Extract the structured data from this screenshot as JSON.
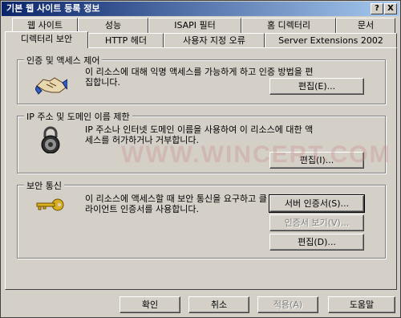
{
  "window": {
    "title": "기본 웹 사이트 등록 정보",
    "help_label": "?",
    "close_label": "X"
  },
  "tabs_row1": [
    {
      "label": "웹 사이트"
    },
    {
      "label": "성능"
    },
    {
      "label": "ISAPI 필터"
    },
    {
      "label": "홈 디렉터리"
    },
    {
      "label": "문서"
    }
  ],
  "tabs_row2": [
    {
      "label": "디렉터리 보안",
      "active": true
    },
    {
      "label": "HTTP 헤더"
    },
    {
      "label": "사용자 지정 오류"
    },
    {
      "label": "Server Extensions 2002"
    }
  ],
  "auth": {
    "title": "인증 및 액세스 제어",
    "description": "이 리소스에 대해 익명 액세스를 가능하게 하고 인증 방법을 편집합니다.",
    "edit_label": "편집(E)...",
    "icon": "handshake-icon"
  },
  "ip": {
    "title": "IP 주소 및 도메인 이름 제한",
    "description": "IP 주소나 인터넷 도메인 이름을 사용하여 이 리소스에 대한 액세스를 허가하거나 거부합니다.",
    "edit_label": "편집(I)...",
    "icon": "padlock-icon"
  },
  "secure": {
    "title": "보안 통신",
    "description": "이 리소스에 액세스할 때 보안 통신을 요구하고 클라이언트 인증서를 사용합니다.",
    "server_cert_label": "서버 인증서(S)...",
    "view_cert_label": "인증서 보기(V)...",
    "edit_label": "편집(D)...",
    "icon": "key-icon"
  },
  "footer": {
    "ok_label": "확인",
    "cancel_label": "취소",
    "apply_label": "적용(A)",
    "help_label": "도움말"
  },
  "watermark": "WWW.WINCERT.COM"
}
